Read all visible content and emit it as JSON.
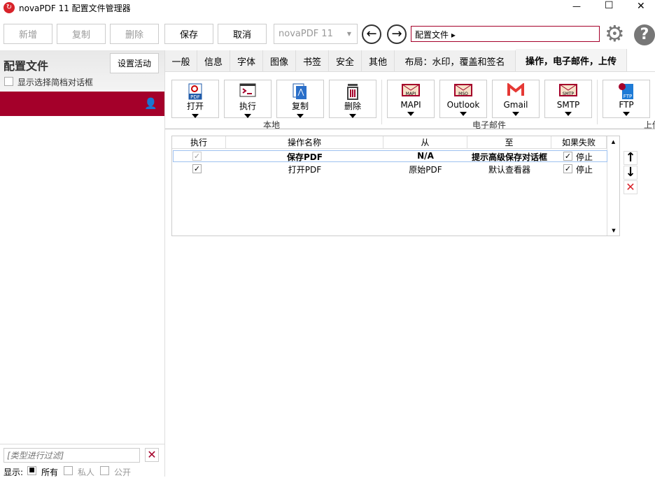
{
  "window": {
    "title": "novaPDF 11 配置文件管理器",
    "minimize": "—",
    "maximize": "☐",
    "close": "✕"
  },
  "toolbar": {
    "new": "新增",
    "copy": "复制",
    "delete": "删除",
    "save": "保存",
    "cancel": "取消",
    "printer": "novaPDF 11",
    "breadcrumb": "配置文件 ▸"
  },
  "left": {
    "title": "配置文件",
    "set_active": "设置活动",
    "show_dialog": "显示选择简档对话框",
    "filter_placeholder": "[类型进行过滤]",
    "show_label": "显示:",
    "all": "所有",
    "private": "私人",
    "public": "公开"
  },
  "tabs": [
    "一般",
    "信息",
    "字体",
    "图像",
    "书签",
    "安全",
    "其他",
    "布局：水印，覆盖和签名",
    "操作，电子邮件，上传"
  ],
  "ribbon": {
    "local": [
      {
        "label": "打开",
        "icon": "open-pdf-icon"
      },
      {
        "label": "执行",
        "icon": "terminal-icon"
      },
      {
        "label": "复制",
        "icon": "copy-pdf-icon"
      },
      {
        "label": "删除",
        "icon": "trash-icon"
      }
    ],
    "email": [
      {
        "label": "MAPI",
        "icon": "mapi-mail-icon"
      },
      {
        "label": "Outlook",
        "icon": "outlook-mail-icon"
      },
      {
        "label": "Gmail",
        "icon": "gmail-icon"
      },
      {
        "label": "SMTP",
        "icon": "smtp-mail-icon"
      }
    ],
    "upload": [
      {
        "label": "FTP",
        "icon": "ftp-icon"
      }
    ],
    "groups": {
      "local": "本地",
      "email": "电子邮件",
      "upload": "上传"
    }
  },
  "grid": {
    "headers": [
      "执行",
      "操作名称",
      "从",
      "至",
      "如果失败"
    ],
    "rows": [
      {
        "exec": true,
        "name": "保存PDF",
        "from": "N/A",
        "to": "提示高级保存对话框",
        "fail": "停止",
        "fail_checked": true
      },
      {
        "exec": true,
        "name": "打开PDF",
        "from": "原始PDF",
        "to": "默认查看器",
        "fail": "停止",
        "fail_checked": true
      }
    ]
  },
  "colors": {
    "accent": "#a4002a"
  }
}
